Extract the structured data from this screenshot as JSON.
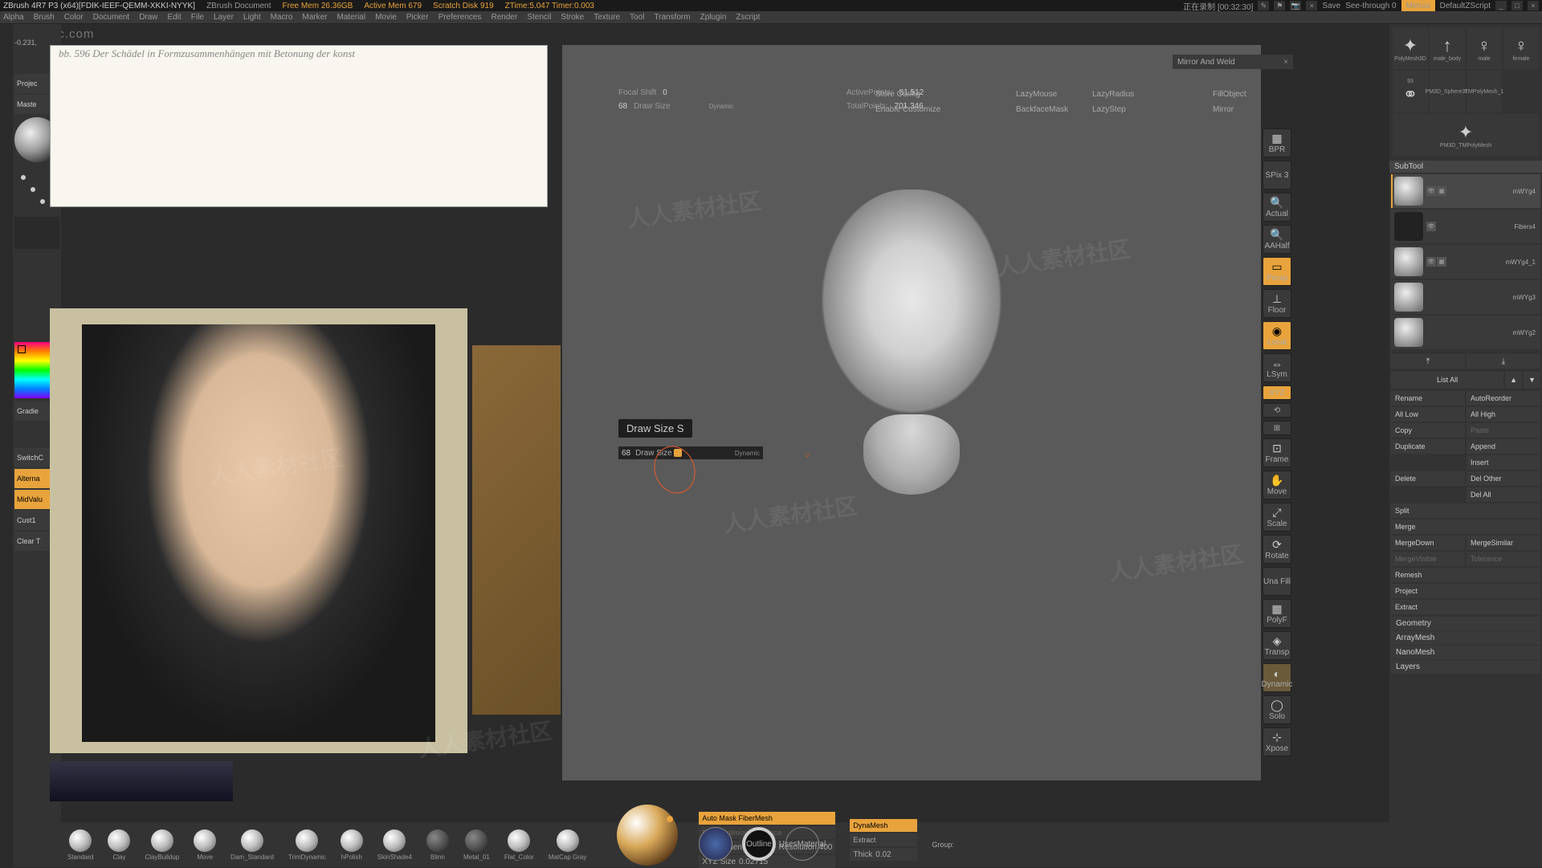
{
  "title": {
    "app": "ZBrush 4R7 P3 (x64)[FDIK-IEEF-QEMM-XKKI-NYYK]",
    "doc": "ZBrush Document",
    "freemem": "Free Mem 26.36GB",
    "activemem": "Active Mem 679",
    "scratch": "Scratch Disk 919",
    "ztime": "ZTime:5.047 Timer:0.003",
    "seethrough": "See-through  0",
    "menus": "Menus",
    "script": "DefaultZScript",
    "rec": "正在录制 [00:32:30]",
    "save": "Save"
  },
  "menu": [
    "Alpha",
    "Brush",
    "Color",
    "Document",
    "Draw",
    "Edit",
    "File",
    "Layer",
    "Light",
    "Macro",
    "Marker",
    "Material",
    "Movie",
    "Picker",
    "Preferences",
    "Render",
    "Stencil",
    "Stroke",
    "Texture",
    "Tool",
    "Transform",
    "Zplugin",
    "Zscript"
  ],
  "left": {
    "coord": "-0.231,",
    "proj": "Projec",
    "master": "Maste",
    "gradient": "Gradie",
    "switchc": "SwitchC",
    "alterna": "Alterna",
    "midvalue": "MidValu",
    "cust1": "Cust1",
    "cleart": "Clear T"
  },
  "ref": {
    "caption": "bb. 596    Der Schädel in Formzusammenhängen mit Betonung der konst"
  },
  "viewport": {
    "focalshift_l": "Focal Shift",
    "focalshift_v": "0",
    "drawsize_l": "Draw Size",
    "drawsize_v": "68",
    "drawsize_dyn": "Dynamic",
    "activepoints_l": "ActivePoints:",
    "activepoints_v": "81,512",
    "totalpoints_l": "TotalPoints:",
    "totalpoints_v": "701,346",
    "storeconfig": "Store Config",
    "enablecustom": "Enable Customize",
    "lazymouse": "LazyMouse",
    "lazyradius": "LazyRadius",
    "lazystep": "LazyStep",
    "backface": "BackfaceMask",
    "fillobject": "FillObject",
    "mirror": "Mirror",
    "mirrorweld": "Mirror And Weld",
    "tooltip": "Draw Size  S",
    "slider_v": "68",
    "slider_l": "Draw Size",
    "slider_dyn": "Dynamic"
  },
  "dock": [
    {
      "l": "BPR",
      "a": false
    },
    {
      "l": "SPix 3",
      "a": false
    },
    {
      "l": "Actual",
      "a": false
    },
    {
      "l": "AAHalf",
      "a": false
    },
    {
      "l": "Persp",
      "a": true
    },
    {
      "l": "Floor",
      "a": false
    },
    {
      "l": "Local",
      "a": true
    },
    {
      "l": "LSym",
      "a": false
    },
    {
      "l": "XYZ",
      "a": true
    },
    {
      "l": "",
      "a": false
    },
    {
      "l": "",
      "a": false
    },
    {
      "l": "Frame",
      "a": false
    },
    {
      "l": "Move",
      "a": false
    },
    {
      "l": "Scale",
      "a": false
    },
    {
      "l": "Rotate",
      "a": false
    },
    {
      "l": "Una Fill",
      "a": false
    },
    {
      "l": "PolyF",
      "a": false
    },
    {
      "l": "Transp",
      "a": false
    },
    {
      "l": "Dynamic",
      "a": false
    },
    {
      "l": "Solo",
      "a": false
    },
    {
      "l": "Xpose",
      "a": false
    }
  ],
  "tools": [
    {
      "n": "PolyMesh3D"
    },
    {
      "n": "male_body"
    },
    {
      "n": "male"
    },
    {
      "n": "female"
    },
    {
      "n": "93"
    },
    {
      "n": "PM3D_Sphere3D"
    },
    {
      "n": "TMPolyMesh_1"
    },
    {
      "n": "PM3D_TMPolyMesh"
    }
  ],
  "subtool_hdr": "SubTool",
  "subtools": [
    {
      "n": "mWYg4",
      "sel": true
    },
    {
      "n": "Fibers4",
      "sel": false
    },
    {
      "n": "mWYg4_1",
      "sel": false
    },
    {
      "n": "mWYg3",
      "sel": false
    },
    {
      "n": "mWYg2",
      "sel": false
    }
  ],
  "listall": "List All",
  "st_buttons": {
    "rename": "Rename",
    "autoreorder": "AutoReorder",
    "alllow": "All Low",
    "allhigh": "All High",
    "copy": "Copy",
    "paste": "Paste",
    "duplicate": "Duplicate",
    "append": "Append",
    "insert": "Insert",
    "delete": "Delete",
    "delother": "Del Other",
    "delall": "Del All",
    "split": "Split",
    "merge": "Merge",
    "mergedown": "MergeDown",
    "mergesimilar": "MergeSimilar",
    "mergevisible": "MergeVisible",
    "tolerance": "Tolerance",
    "remesh": "Remesh",
    "project": "Project",
    "extract": "Extract"
  },
  "accordions": [
    "Geometry",
    "ArrayMesh",
    "NanoMesh",
    "Layers"
  ],
  "brushes": [
    {
      "n": "Standard"
    },
    {
      "n": "Clay"
    },
    {
      "n": "ClayBuildup"
    },
    {
      "n": "Move"
    },
    {
      "n": "Dam_Standard"
    },
    {
      "n": "TrimDynamic"
    },
    {
      "n": "hPolish"
    },
    {
      "n": "SkinShade4"
    },
    {
      "n": "Blinn"
    },
    {
      "n": "Metal_01"
    },
    {
      "n": "Flat_Color"
    },
    {
      "n": "MatCap Gray"
    }
  ],
  "centercircles": [
    "",
    "Outline",
    "UsesMaterial"
  ],
  "dynamesh": {
    "automask": "Auto Mask FiberMesh",
    "front": "Front Collision Tolerance",
    "delhidden": "Del Hidden",
    "resolution_l": "Resolution",
    "resolution_v": "400",
    "xyzsize_l": "XYZ Size",
    "xyzsize_v": "0.02715",
    "dynamesh": "DynaMesh",
    "extract": "Extract",
    "thick_l": "Thick",
    "thick_v": "0.02",
    "groups": "Group:"
  },
  "watermark": "人人素材社区",
  "url": "www.rr-sc.com"
}
